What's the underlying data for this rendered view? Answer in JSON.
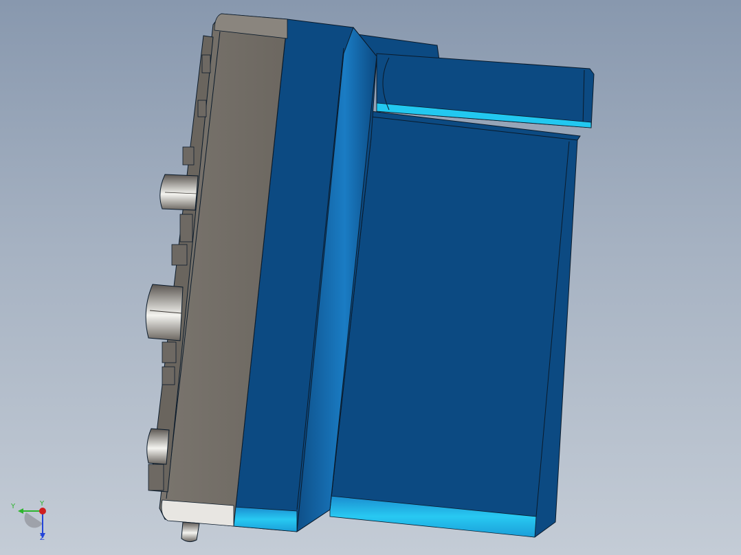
{
  "viewport": {
    "background_top": "#8898ae",
    "background_bottom": "#c4ccd6"
  },
  "model": {
    "body_color": "#0c4a82",
    "highlight_color": "#22c8f0",
    "panel_color": "#716c65",
    "edge_color": "#0a1a2a"
  },
  "triad": {
    "x_label": "Y",
    "y_label": "Y",
    "z_label": "Z",
    "y_axis_color": "#2db52d",
    "z_axis_color": "#2344d8",
    "x_axis_color": "#d01f1f"
  }
}
